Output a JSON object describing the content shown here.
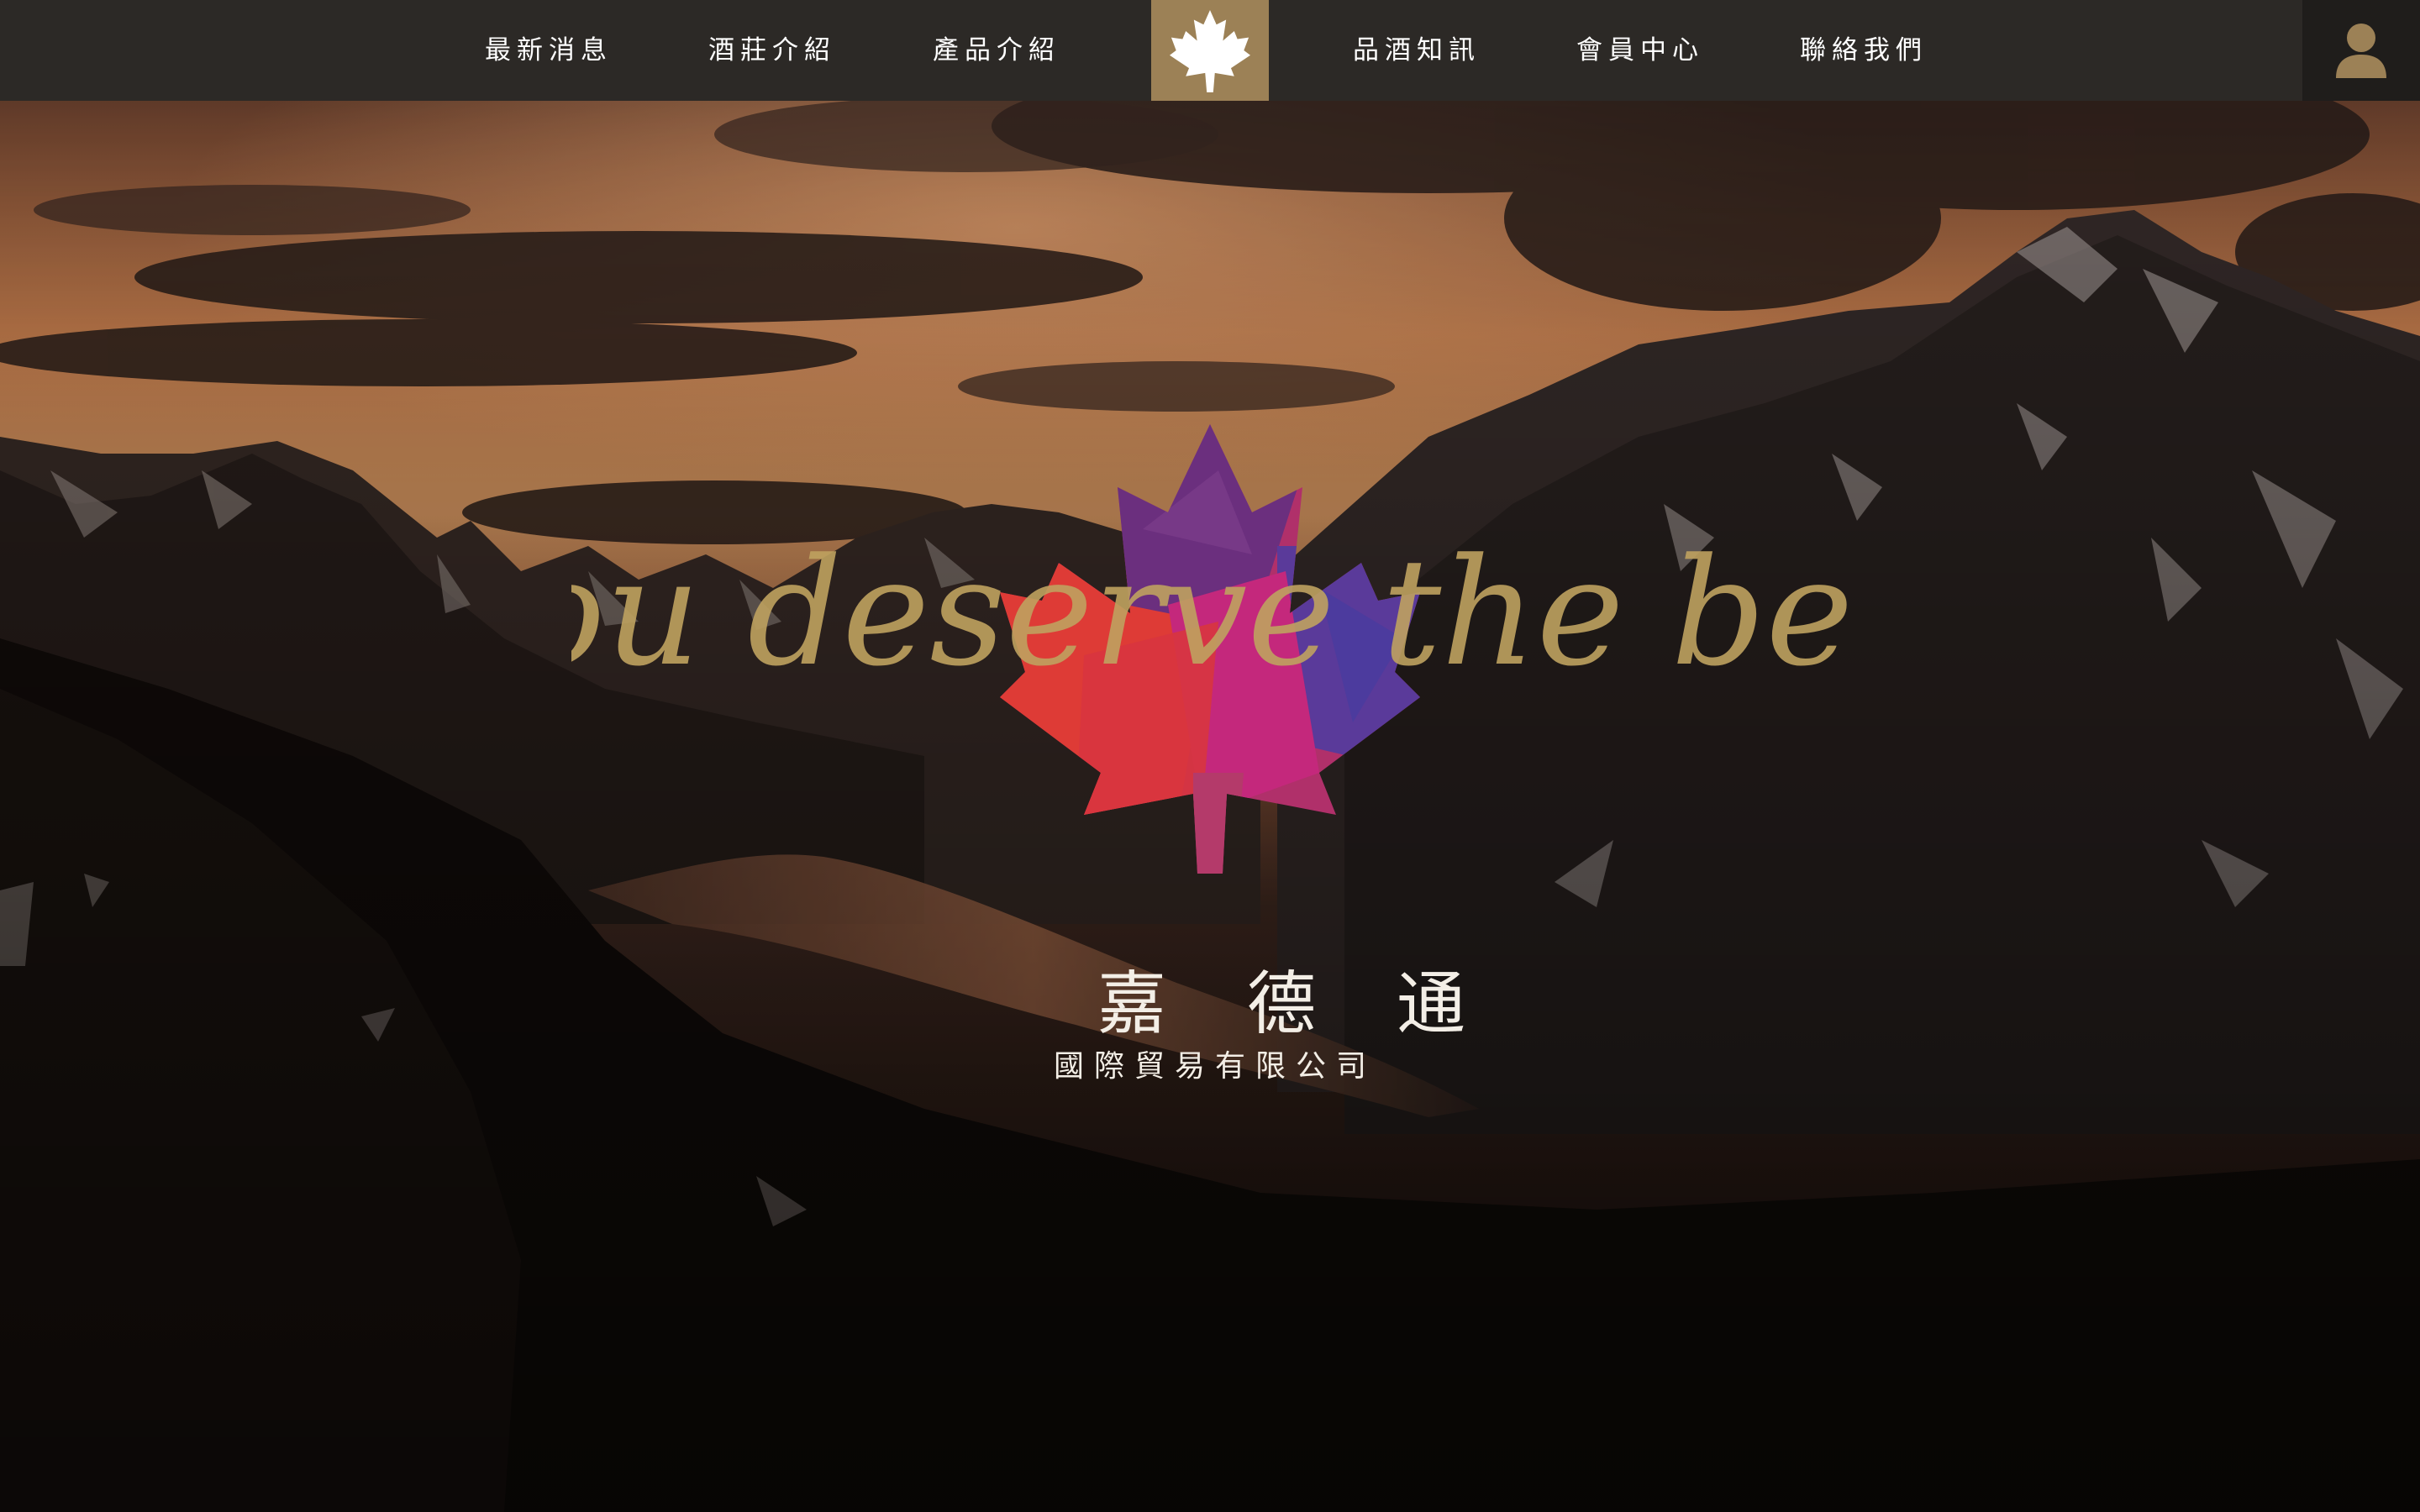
{
  "nav": {
    "items": [
      {
        "label": "最新消息",
        "icon": ""
      },
      {
        "label": "酒莊介紹",
        "icon": ""
      },
      {
        "label": "產品介紹",
        "icon": ""
      },
      {
        "label": "品酒知訊",
        "icon": ""
      },
      {
        "label": "會員中心",
        "icon": ""
      },
      {
        "label": "聯絡我們",
        "icon": ""
      }
    ],
    "logo_icon": "maple-leaf-icon",
    "user_icon": "user-icon",
    "bar_color": "#2c2926",
    "logo_color": "#9c8156"
  },
  "hero": {
    "tagline": "You deserve the best",
    "tagline_color": "#bfa25f",
    "company_name": "嘉德通",
    "company_subtitle": "國際貿易有限公司",
    "emblem_icon": "maple-leaf-logo-icon"
  }
}
